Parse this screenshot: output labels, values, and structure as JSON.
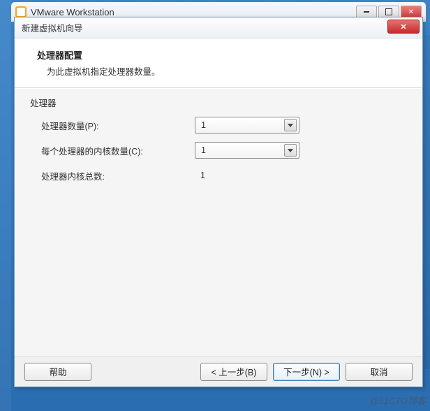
{
  "parent_window": {
    "title": "VMware Workstation"
  },
  "dialog": {
    "title": "新建虚拟机向导",
    "header": {
      "title": "处理器配置",
      "subtitle": "为此虚拟机指定处理器数量。"
    },
    "group": {
      "label": "处理器",
      "rows": {
        "cpu_count": {
          "label": "处理器数量(P):",
          "value": "1"
        },
        "cores_per": {
          "label": "每个处理器的内核数量(C):",
          "value": "1"
        },
        "total_cores": {
          "label": "处理器内核总数:",
          "value": "1"
        }
      }
    },
    "buttons": {
      "help": "帮助",
      "back": "< 上一步(B)",
      "next": "下一步(N) >",
      "cancel": "取消"
    }
  },
  "watermark": "@51CTO博客"
}
